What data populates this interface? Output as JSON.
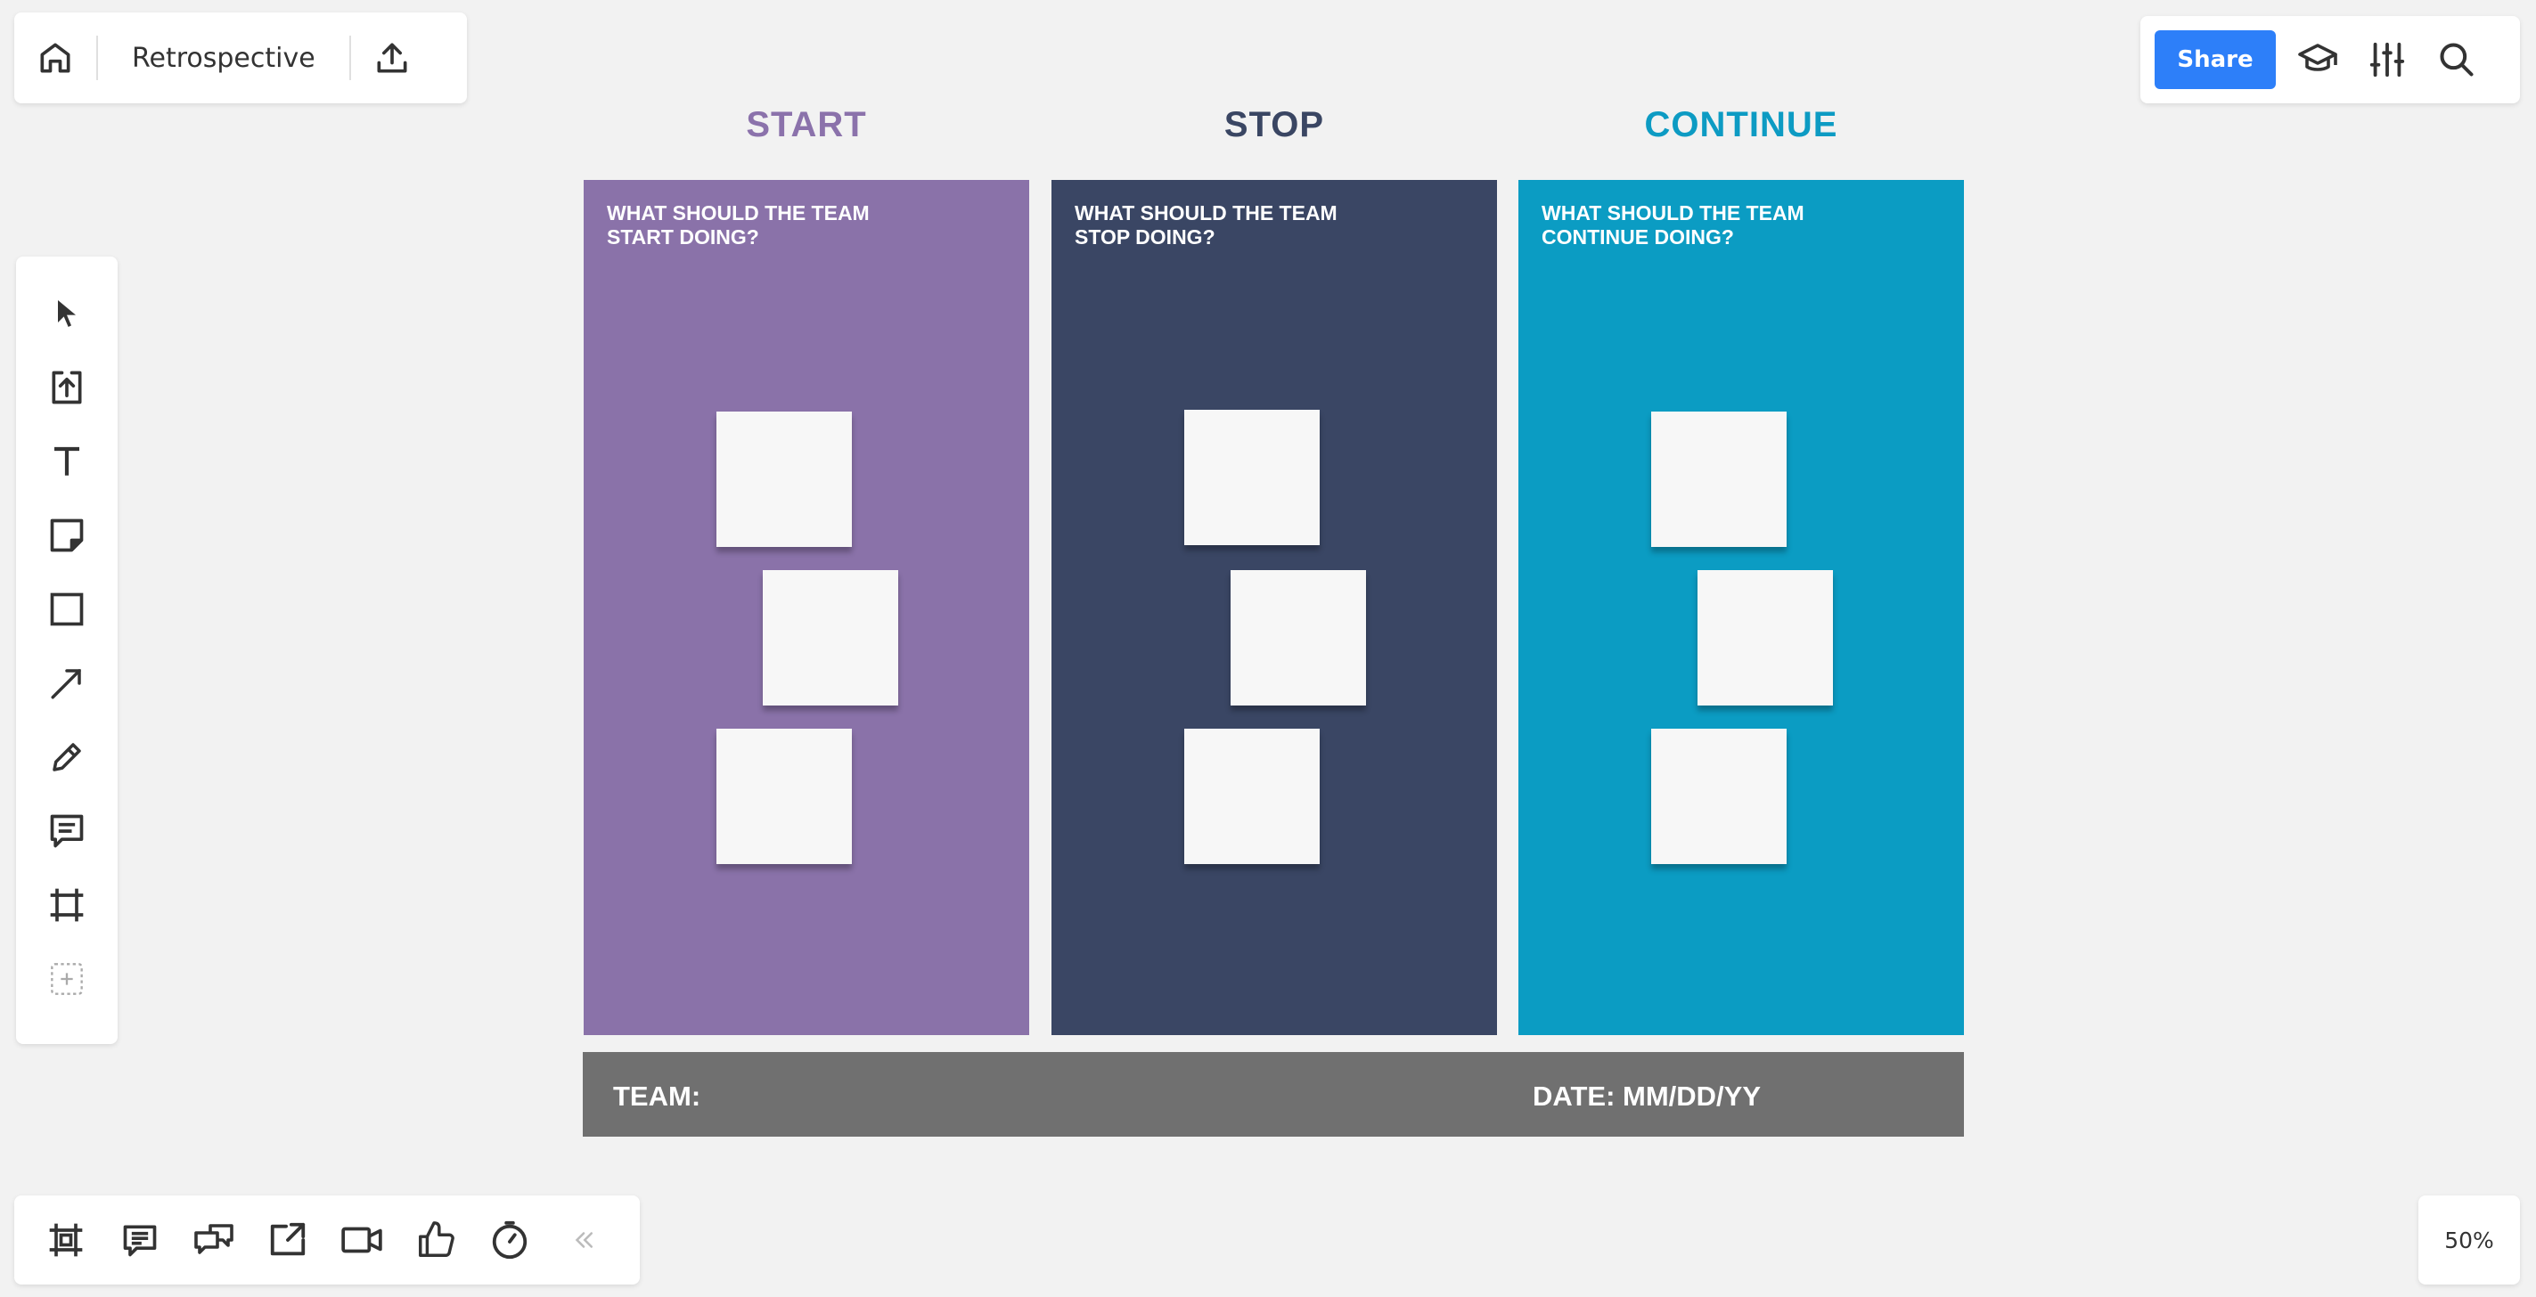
{
  "board": {
    "title": "Retrospective"
  },
  "toolbar_top_right": {
    "share_label": "Share"
  },
  "zoom": {
    "level": "50%"
  },
  "columns": [
    {
      "heading": "START",
      "prompt": "WHAT SHOULD THE TEAM\nSTART DOING?",
      "heading_color": "#8b72ab",
      "bg_color": "#8a72a9"
    },
    {
      "heading": "STOP",
      "prompt": "WHAT SHOULD THE TEAM\nSTOP DOING?",
      "heading_color": "#3a4663",
      "bg_color": "#3a4664"
    },
    {
      "heading": "CONTINUE",
      "prompt": "WHAT SHOULD THE TEAM\nCONTINUE DOING?",
      "heading_color": "#0d9bc3",
      "bg_color": "#0b9cc3"
    }
  ],
  "footer": {
    "team_label": "TEAM:",
    "date_label": "DATE: MM/DD/YY",
    "bg_color": "#707070"
  },
  "icons": {
    "top_left": [
      "home-icon",
      "export-icon"
    ],
    "top_right": [
      "learn-icon",
      "settings-sliders-icon",
      "search-icon"
    ],
    "left_toolbar": [
      "select-cursor-icon",
      "upload-icon",
      "text-icon",
      "sticky-note-icon",
      "rectangle-icon",
      "arrow-line-icon",
      "pen-icon",
      "comment-icon",
      "frame-icon",
      "add-more-icon"
    ],
    "bottom_toolbar": [
      "frames-icon",
      "comments-list-icon",
      "chat-icon",
      "share-screen-icon",
      "video-icon",
      "vote-icon",
      "timer-icon",
      "collapse-icon"
    ]
  },
  "brand": {
    "accent": "#2d7ff9"
  }
}
